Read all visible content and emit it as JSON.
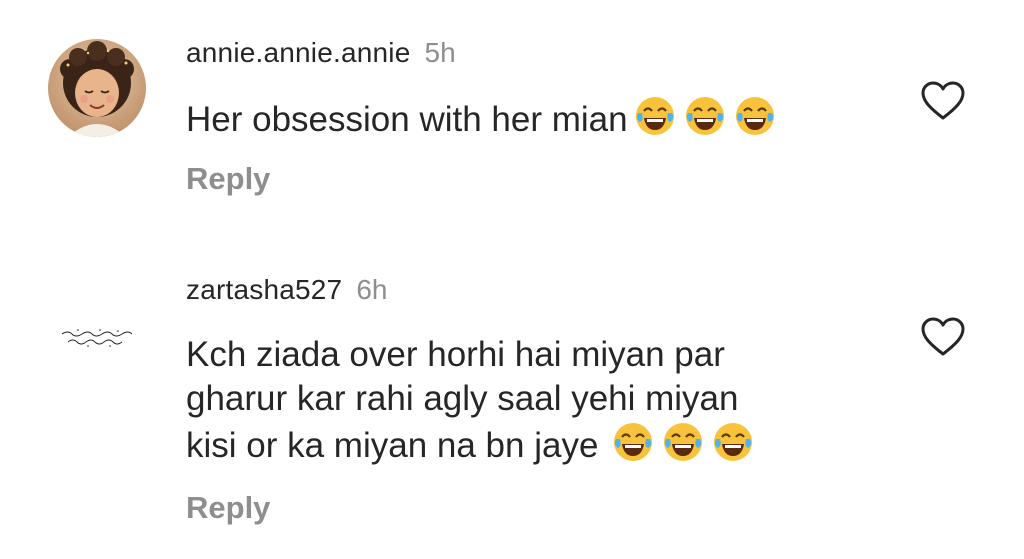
{
  "comments": [
    {
      "username": "annie.annie.annie",
      "time": "5h",
      "text": "Her obsession with her mian",
      "emojis": [
        "face-with-tears-of-joy",
        "face-with-tears-of-joy",
        "face-with-tears-of-joy"
      ],
      "reply_label": "Reply",
      "avatar": "illustrated-girl-avatar",
      "like_icon": "heart-outline"
    },
    {
      "username": "zartasha527",
      "time": "6h",
      "text_lines": [
        "Kch ziada over horhi hai miyan par",
        "gharur kar rahi agly saal yehi miyan",
        "kisi or ka miyan na bn jaye"
      ],
      "emojis": [
        "face-with-tears-of-joy",
        "face-with-tears-of-joy",
        "face-with-tears-of-joy"
      ],
      "reply_label": "Reply",
      "avatar": "urdu-text-avatar",
      "like_icon": "heart-outline"
    }
  ],
  "colors": {
    "text": "#262626",
    "secondary": "#8e8e8e",
    "background": "#ffffff"
  }
}
